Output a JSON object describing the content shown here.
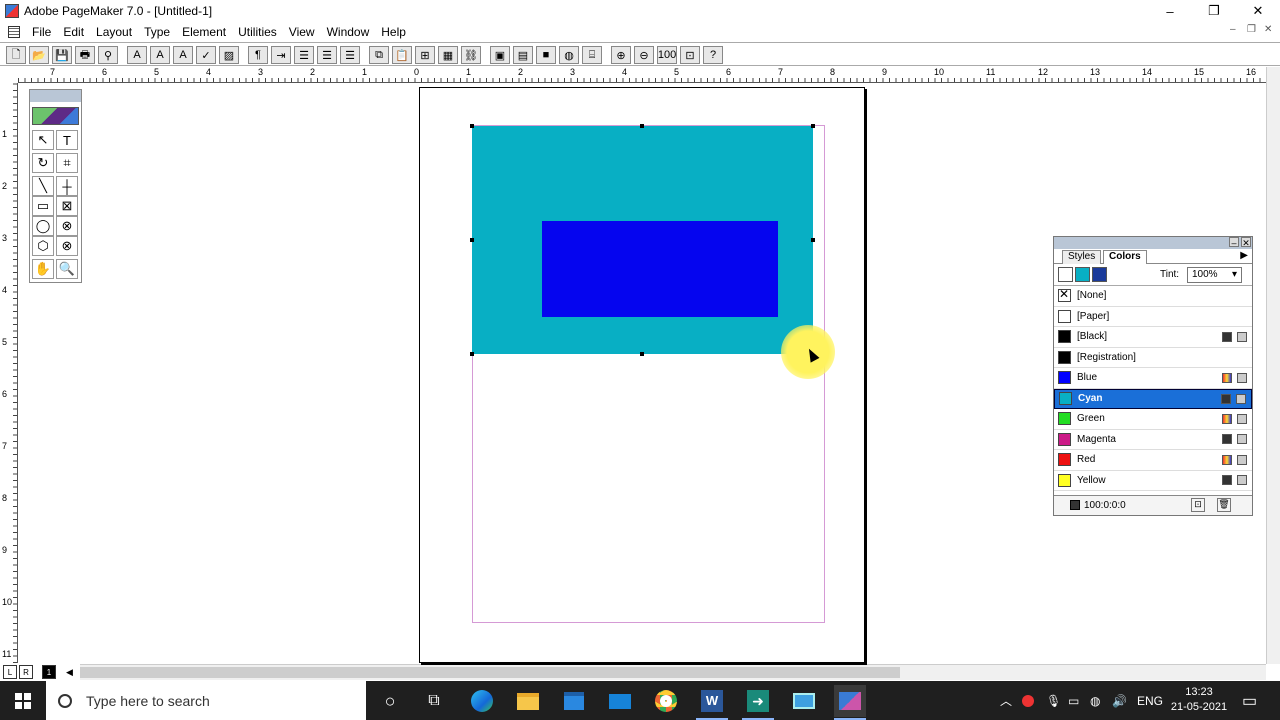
{
  "window": {
    "title": "Adobe PageMaker 7.0 - [Untitled-1]",
    "minimize_icon": "–",
    "restore_icon": "❐",
    "close_icon": "✕",
    "mdi_minimize": "–",
    "mdi_restore": "❐",
    "mdi_close": "✕"
  },
  "menu": [
    "File",
    "Edit",
    "Layout",
    "Type",
    "Element",
    "Utilities",
    "View",
    "Window",
    "Help"
  ],
  "ruler": {
    "top": [
      "7",
      "6",
      "5",
      "4",
      "3",
      "2",
      "1",
      "0",
      "1",
      "2",
      "3",
      "4",
      "5",
      "6",
      "7",
      "8",
      "9",
      "10",
      "11",
      "12",
      "13",
      "14",
      "15",
      "16"
    ],
    "left": [
      "1",
      "2",
      "3",
      "4",
      "5",
      "6",
      "7",
      "8",
      "9",
      "10",
      "11"
    ]
  },
  "toolbox": {
    "tools": [
      "↖",
      "T",
      "↻",
      "⌗",
      "╲",
      "┼",
      "▭",
      "⊠",
      "◯",
      "⊗",
      "⬡",
      "⊗",
      "✋",
      "🔍"
    ]
  },
  "palette": {
    "tabs": [
      "Styles",
      "Colors"
    ],
    "tint_label": "Tint:",
    "tint_value": "100%",
    "colors": [
      {
        "name": "[None]",
        "swatch": "#ffffff"
      },
      {
        "name": "[Paper]",
        "swatch": "#ffffff"
      },
      {
        "name": "[Black]",
        "swatch": "#000000"
      },
      {
        "name": "[Registration]",
        "swatch": "#000000"
      },
      {
        "name": "Blue",
        "swatch": "#0000ff"
      },
      {
        "name": "Cyan",
        "swatch": "#08afc4"
      },
      {
        "name": "Green",
        "swatch": "#22dd22"
      },
      {
        "name": "Magenta",
        "swatch": "#cc1a88"
      },
      {
        "name": "Red",
        "swatch": "#ee1111"
      },
      {
        "name": "Yellow",
        "swatch": "#ffff22"
      }
    ],
    "cmyk": "100:0:0:0"
  },
  "page_tabs": [
    "L",
    "R",
    "1"
  ],
  "taskbar": {
    "search_placeholder": "Type here to search",
    "lang": "ENG",
    "time": "13:23",
    "date": "21-05-2021"
  },
  "colors": {
    "cyan_fill": "#08afc4",
    "blue_fill": "#0505ef",
    "selection": "#1a6fd8"
  }
}
